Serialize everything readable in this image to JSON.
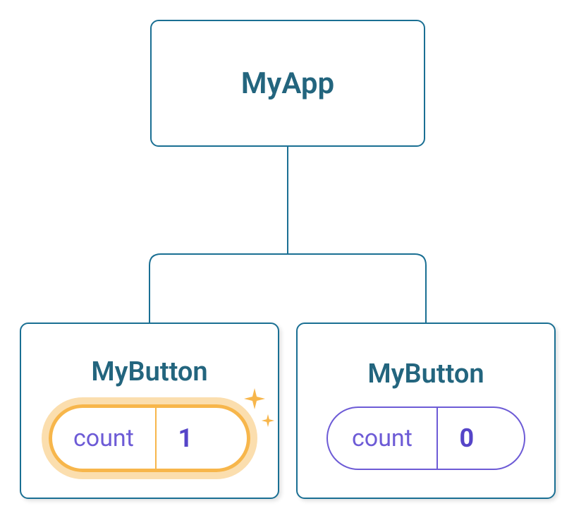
{
  "root": {
    "label": "MyApp"
  },
  "children": {
    "left": {
      "label": "MyButton",
      "pill": {
        "label": "count",
        "value": "1"
      },
      "highlighted": true
    },
    "right": {
      "label": "MyButton",
      "pill": {
        "label": "count",
        "value": "0"
      },
      "highlighted": false
    }
  }
}
